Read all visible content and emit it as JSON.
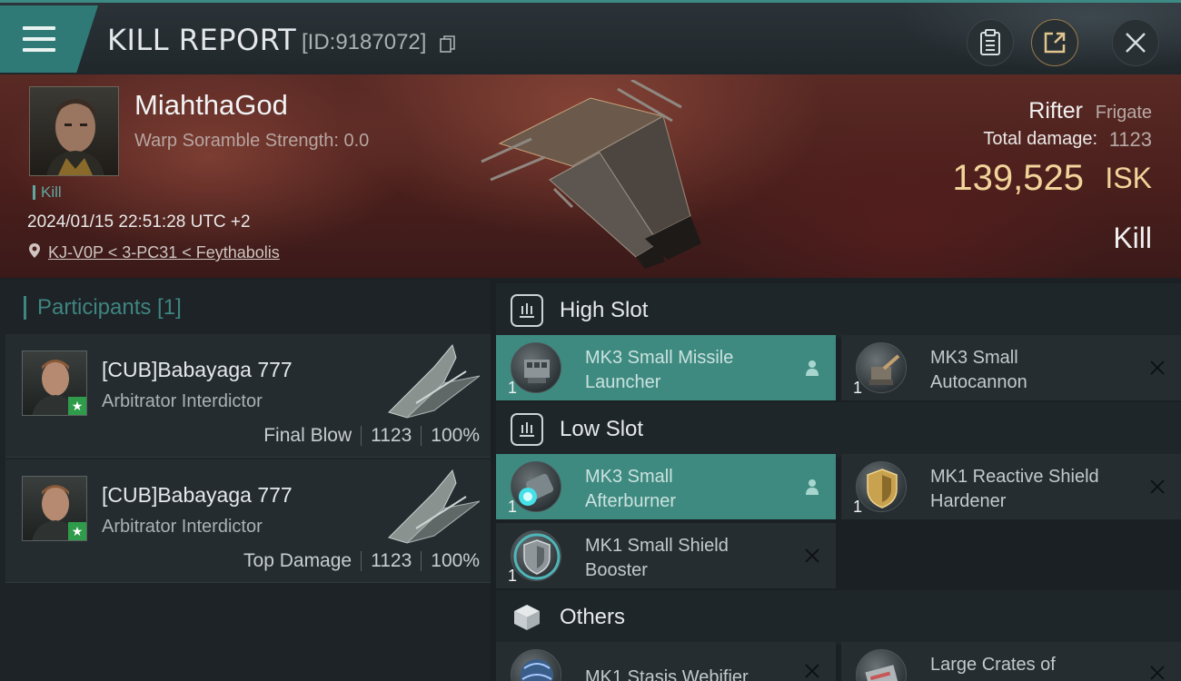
{
  "header": {
    "title": "KILL REPORT",
    "report_id": "[ID:9187072]"
  },
  "victim": {
    "name": "MiahthaGod",
    "warp_scramble": "Warp Soramble Strength: 0.0",
    "tag": "Kill",
    "timestamp": "2024/01/15 22:51:28 UTC +2",
    "location": "KJ-V0P < 3-PC31 < Feythabolis",
    "ship_name": "Rifter",
    "ship_class": "Frigate",
    "total_damage_label": "Total damage:",
    "total_damage": "1123",
    "isk_value": "139,525",
    "isk_unit": "ISK",
    "result": "Kill"
  },
  "participants": {
    "header": "Participants [1]",
    "items": [
      {
        "name": "[CUB]Babayaga 777",
        "ship": "Arbitrator Interdictor",
        "role": "Final Blow",
        "damage": "1123",
        "percent": "100%"
      },
      {
        "name": "[CUB]Babayaga 777",
        "ship": "Arbitrator Interdictor",
        "role": "Top Damage",
        "damage": "1123",
        "percent": "100%"
      }
    ]
  },
  "fitting": {
    "high_slot": {
      "label": "High Slot",
      "modules": [
        {
          "qty": "1",
          "line1": "MK3 Small Missile",
          "line2": "Launcher",
          "status": "user-icon"
        },
        {
          "qty": "1",
          "line1": "MK3 Small",
          "line2": "Autocannon",
          "status": "close-icon"
        }
      ]
    },
    "low_slot": {
      "label": "Low Slot",
      "modules": [
        {
          "qty": "1",
          "line1": "MK3 Small",
          "line2": "Afterburner",
          "status": "user-icon"
        },
        {
          "qty": "1",
          "line1": "MK1 Reactive Shield",
          "line2": "Hardener",
          "status": "close-icon"
        },
        {
          "qty": "1",
          "line1": "MK1 Small Shield",
          "line2": "Booster",
          "status": "close-icon"
        }
      ]
    },
    "others": {
      "label": "Others",
      "modules": [
        {
          "line1": "MK1 Stasis Webifier",
          "status": "close-icon"
        },
        {
          "line1": "Large Crates of",
          "status": "close-icon"
        }
      ]
    }
  },
  "colors": {
    "accent": "#3f8a80",
    "isk": "#f2d49a",
    "banner": "#4a1f1c"
  }
}
